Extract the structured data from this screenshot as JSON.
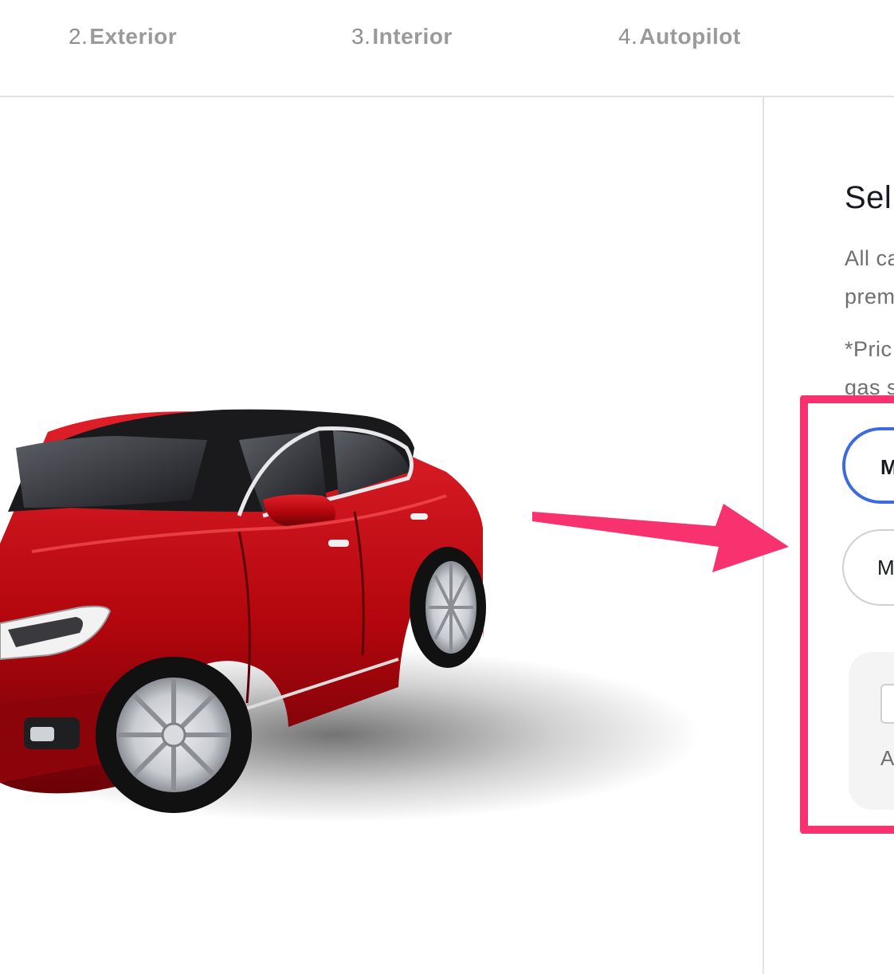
{
  "steps": [
    {
      "num": "2.",
      "label": "Exterior"
    },
    {
      "num": "3.",
      "label": "Interior"
    },
    {
      "num": "4.",
      "label": "Autopilot"
    }
  ],
  "car": {
    "paint_color": "#b3060d",
    "paint_highlight": "#e0202a",
    "tire_color": "#111111",
    "wheel_color": "#c9ccd1"
  },
  "config": {
    "title": "Sel",
    "description_lines": [
      "All ca",
      "prem"
    ],
    "note_lines": [
      "*Pric",
      "gas s"
    ],
    "options": [
      {
        "label": "M",
        "selected": true
      },
      {
        "label": "M",
        "selected": false
      }
    ],
    "upgrade_label": "A"
  },
  "annotation": {
    "color": "#f7326e"
  },
  "colors": {
    "selected_border": "#3e6ae1",
    "divider": "#e2e2e2"
  }
}
